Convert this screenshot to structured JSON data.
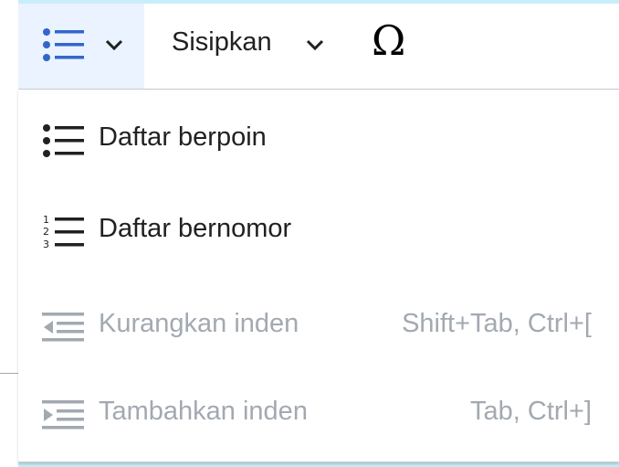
{
  "toolbar": {
    "list_button": {
      "icon": "bullet-list-icon",
      "dropdown_icon": "chevron-down-icon",
      "active_bg": "#eaf3ff",
      "icon_color": "#3366cc"
    },
    "insert_button": {
      "label": "Sisipkan",
      "dropdown_icon": "chevron-down-icon"
    },
    "special_char_button": {
      "glyph": "Ω",
      "icon": "omega-icon"
    }
  },
  "menu": {
    "items": [
      {
        "label": "Daftar berpoin",
        "shortcut": "",
        "icon": "bullet-list-icon",
        "enabled": true
      },
      {
        "label": "Daftar bernomor",
        "shortcut": "",
        "icon": "numbered-list-icon",
        "enabled": true
      },
      {
        "label": "Kurangkan inden",
        "shortcut": "Shift+Tab, Ctrl+[",
        "icon": "outdent-icon",
        "enabled": false
      },
      {
        "label": "Tambahkan inden",
        "shortcut": "Tab, Ctrl+]",
        "icon": "indent-icon",
        "enabled": false
      }
    ]
  },
  "colors": {
    "background": "#c8eefa",
    "text": "#202122",
    "disabled_text": "#a2a9b1",
    "accent": "#3366cc"
  }
}
